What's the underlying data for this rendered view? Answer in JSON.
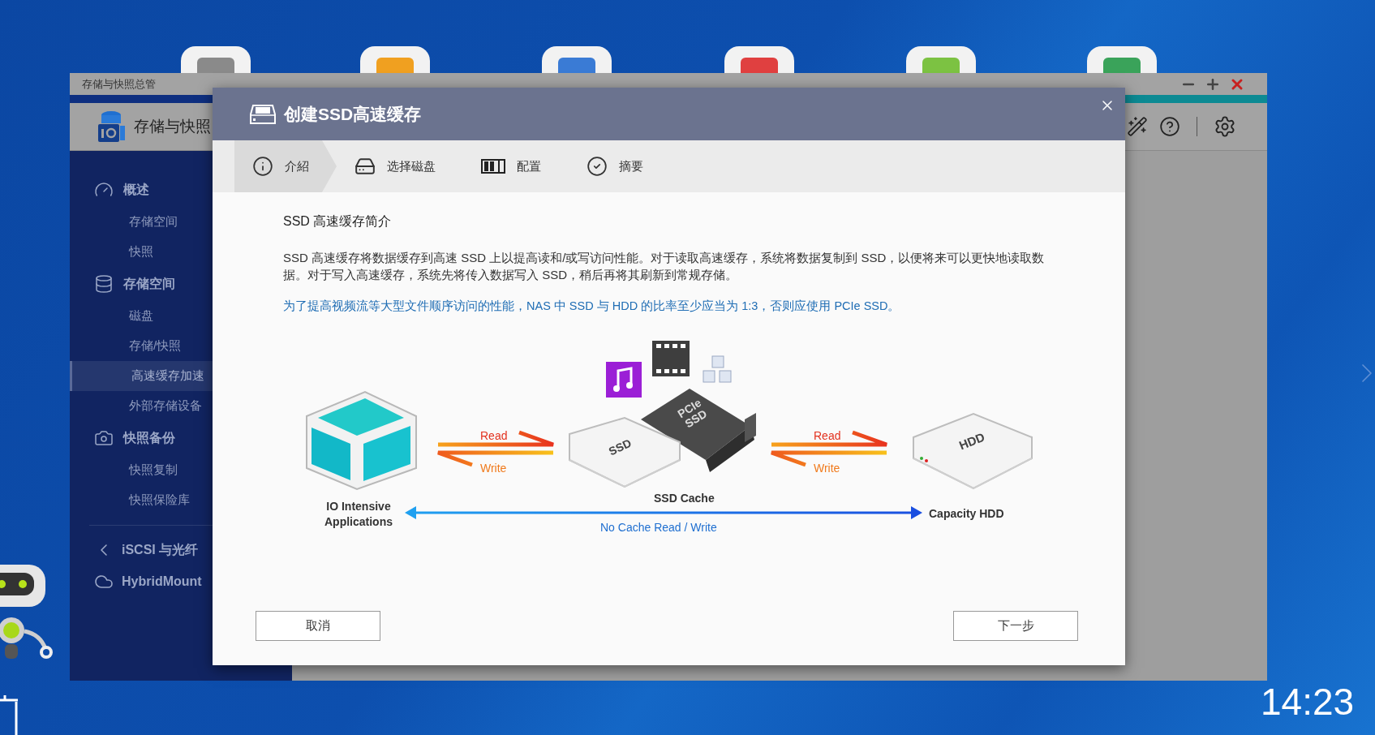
{
  "desktop": {
    "clock": "14:23"
  },
  "window": {
    "title": "存储与快照总管",
    "app_title": "存储与快照"
  },
  "sidebar": {
    "groups": [
      {
        "label": "概述",
        "items": [
          {
            "label": "存储空间",
            "selected": false
          },
          {
            "label": "快照",
            "selected": false
          }
        ]
      },
      {
        "label": "存储空间",
        "items": [
          {
            "label": "磁盘",
            "selected": false
          },
          {
            "label": "存储/快照",
            "selected": false
          },
          {
            "label": "高速缓存加速",
            "selected": true
          },
          {
            "label": "外部存储设备",
            "selected": false
          }
        ]
      },
      {
        "label": "快照备份",
        "items": [
          {
            "label": "快照复制",
            "selected": false
          },
          {
            "label": "快照保险库",
            "selected": false
          }
        ]
      }
    ],
    "links": [
      {
        "label": "iSCSI 与光纤"
      },
      {
        "label": "HybridMount"
      }
    ]
  },
  "dialog": {
    "title": "创建SSD高速缓存",
    "steps": [
      {
        "label": "介紹",
        "selected": true
      },
      {
        "label": "选择磁盘",
        "selected": false
      },
      {
        "label": "配置",
        "selected": false
      },
      {
        "label": "摘要",
        "selected": false
      }
    ],
    "heading": "SSD 高速缓存简介",
    "paragraph": "SSD 高速缓存将数据缓存到高速 SSD 上以提高读和/或写访问性能。对于读取高速缓存，系统将数据复制到 SSD，以便将来可以更快地读取数据。对于写入高速缓存，系统先将传入数据写入 SSD，稍后再将其刷新到常规存储。",
    "note": "为了提高视频流等大型文件顺序访问的性能，NAS 中 SSD 与 HDD 的比率至少应当为 1:3，否则应使用 PCIe SSD。",
    "diagram": {
      "read_left": "Read",
      "write_left": "Write",
      "ssd_drive": "SSD",
      "pcie_card": "PCIe SSD",
      "ssd_cache": "SSD Cache",
      "read_right": "Read",
      "write_right": "Write",
      "hdd_drive": "HDD",
      "io_apps": "IO Intensive Applications",
      "no_cache": "No Cache Read / Write",
      "capacity": "Capacity HDD"
    },
    "buttons": {
      "cancel": "取消",
      "next": "下一步"
    }
  }
}
